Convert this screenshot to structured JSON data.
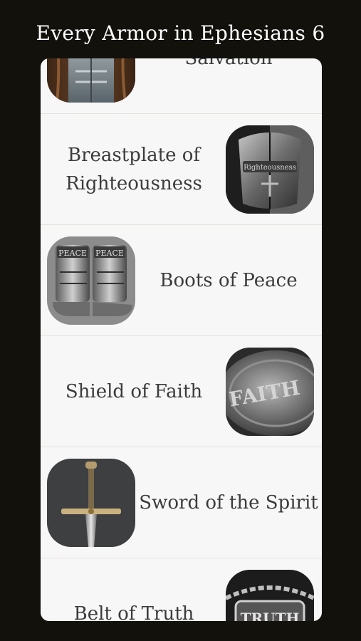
{
  "header": {
    "title": "Every Armor in Ephesians 6"
  },
  "items": [
    {
      "label": "Salvation",
      "image": "helmet-icon"
    },
    {
      "label": "Breastplate of Righteousness",
      "image": "breastplate-icon",
      "engraving": "Righteousness"
    },
    {
      "label": "Boots of Peace",
      "image": "boots-icon",
      "engraving": "PEACE"
    },
    {
      "label": "Shield of Faith",
      "image": "shield-icon",
      "engraving": "FAITH"
    },
    {
      "label": "Sword of the Spirit",
      "image": "sword-icon"
    },
    {
      "label": "Belt of Truth",
      "image": "belt-icon",
      "engraving": "TRUTH"
    }
  ]
}
